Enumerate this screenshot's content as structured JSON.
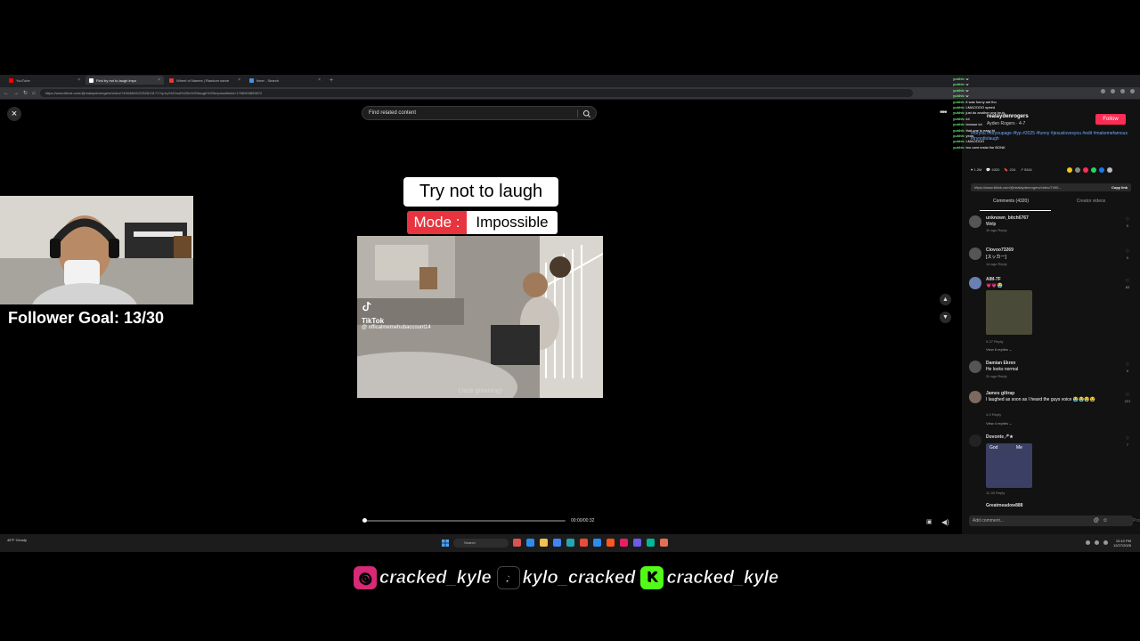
{
  "browser": {
    "tabs": [
      {
        "label": "YouTube",
        "favicon_color": "#ff0000",
        "active": false
      },
      {
        "label": "Find try not to laugh impo",
        "favicon_color": "#ffffff",
        "active": true
      },
      {
        "label": "Wheel of Names | Random name",
        "favicon_color": "#e53935",
        "active": false
      },
      {
        "label": "timer - Search",
        "favicon_color": "#4a90e2",
        "active": false
      }
    ],
    "url": "https://www.tiktok.com/@realaydenrogers/video/7490484912252813171?q=try%20not%20to%20laugh%20impossible&t=1766903853872"
  },
  "player": {
    "search_placeholder": "Find related content",
    "title_text": "Try not to laugh",
    "mode_label": "Mode :",
    "mode_value": "Impossible",
    "watermark_name": "TikTok",
    "watermark_handle": "@ officalmemehubaccount14",
    "caption": "(Jack groaning)",
    "time": "00:00/00:32",
    "progress": 0.01
  },
  "side_panel": {
    "creator": "realaydenrogers",
    "creator_sub": "Ayden Rogers · 4-7",
    "follow_label": "Follow",
    "description": "#foryou #foryoupage #fyp #2025 #funny #jesuslovesyou #edit #makemefamous #trynottolaugh",
    "stats": [
      "♥ 1.2M",
      "💬 4320",
      "🔖 21K",
      "↗ 5341"
    ],
    "link_text": "https://www.tiktok.com/@realaydenrogers/video/7490...",
    "copy_link": "Copy link",
    "tab_comments": "Comments (4320)",
    "tab_creator": "Creator videos",
    "comments": [
      {
        "user": "unknown_bitch6767",
        "text": "Welp",
        "meta": "1h ago   Reply",
        "likes": "0"
      },
      {
        "user": "Clovoo73269",
        "text": "[スッカー]",
        "meta": "1d ago   Reply",
        "likes": "0"
      },
      {
        "user": "AIM-7F",
        "text": "💗💗😭",
        "meta": "9-27   Reply",
        "likes": "83",
        "replies": "View 6 replies ⌄"
      },
      {
        "user": "Damian Ekren",
        "text": "He looks normal",
        "meta": "2h ago   Reply",
        "likes": "0"
      },
      {
        "user": "James giltrap",
        "text": "I laughed as soon as I heard the guys voice 😭😭😭😭",
        "meta": "4-9   Reply",
        "likes": "221",
        "replies": "View 4 replies ⌄"
      },
      {
        "user": "Dovonte🎤★",
        "text": "",
        "meta": "11-30   Reply",
        "likes": "7",
        "sticker_labels": [
          "God",
          "Me"
        ]
      },
      {
        "user": "Greatmeadow888",
        "text": "",
        "meta": "",
        "likes": ""
      }
    ],
    "add_comment": "Add comment...",
    "post_label": "Post"
  },
  "chat": {
    "lines": [
      {
        "user": "yuhhh",
        "text": "w"
      },
      {
        "user": "yuhhh",
        "text": "w"
      },
      {
        "user": "yuhhh",
        "text": "w"
      },
      {
        "user": "yuhhh",
        "text": "w"
      },
      {
        "user": "yuhhh",
        "text": "it was funny asf tho"
      },
      {
        "user": "yuhhh",
        "text": "LMAOOOO speed"
      },
      {
        "user": "yuhhh",
        "text": "just do another one bruh"
      },
      {
        "user": "yuhhh",
        "text": "lol"
      },
      {
        "user": "yuhhh",
        "text": "browse lol"
      },
      {
        "user": "yuhhh",
        "text": "that one is easy bt"
      },
      {
        "user": "yuhhh",
        "text": "yeah"
      },
      {
        "user": "yuhhh",
        "text": "LMAOOOO"
      },
      {
        "user": "yuhhh",
        "text": "bro cant resist the BONK"
      }
    ]
  },
  "taskbar": {
    "weather": "46°F Cloudy",
    "search": "Search",
    "clock_time": "10:10 PM",
    "clock_date": "12/27/2025",
    "app_colors": [
      "#d9534f",
      "#2d8cf0",
      "#f2c14e",
      "#4285f4",
      "#22a6b3",
      "#e74c3c",
      "#2d8cf0",
      "#ff5722",
      "#e91e63",
      "#6c5ce7",
      "#00b894",
      "#e17055"
    ]
  },
  "stream": {
    "follower_goal": "Follower Goal: 13/30",
    "socials": [
      {
        "platform_icon": "instagram-icon",
        "handle": "cracked_kyle"
      },
      {
        "platform_icon": "tiktok-icon",
        "handle": "kylo_cracked"
      },
      {
        "platform_icon": "kick-icon",
        "handle": "cracked_kyle"
      }
    ]
  }
}
